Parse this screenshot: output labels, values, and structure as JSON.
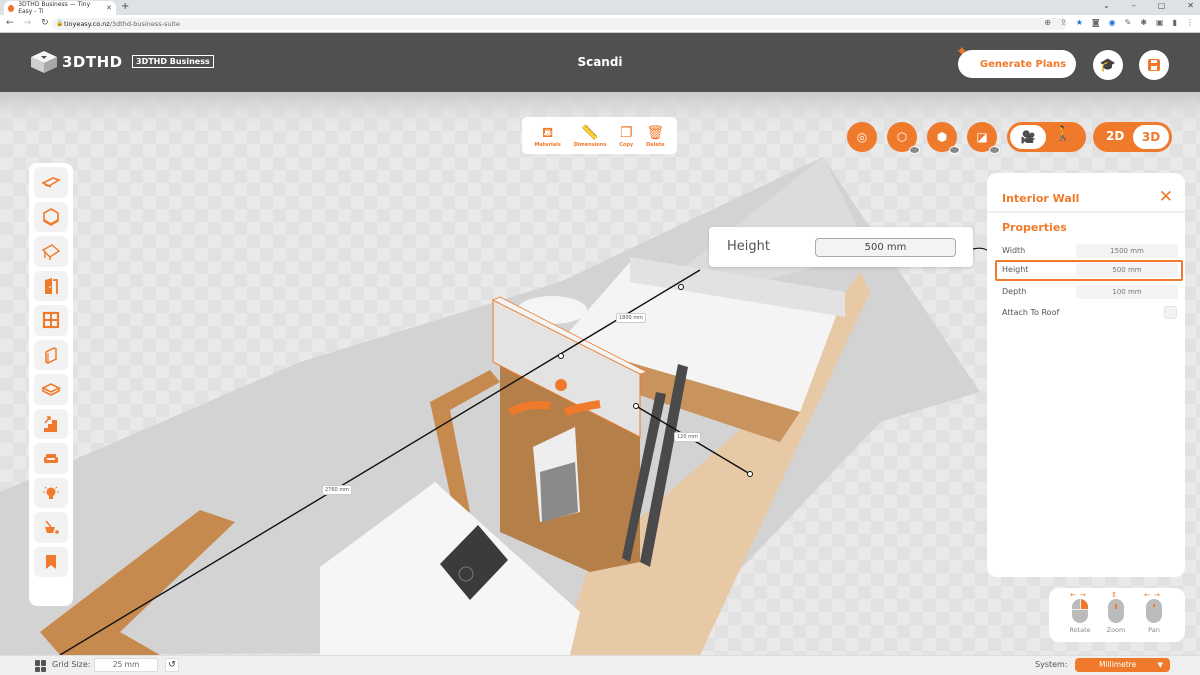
{
  "browser": {
    "tab_title": "3DTHD Business — Tiny Easy - Ti",
    "new_tab": "+",
    "url_host": "tinyeasy.co.nz",
    "url_path": "/3dthd-business-suite",
    "window_controls": [
      "⌄",
      "–",
      "▢",
      "✕"
    ]
  },
  "header": {
    "logo_text": "3DTHD",
    "edition_badge": "3DTHD Business",
    "project_title": "Scandi",
    "generate_plans_label": "Generate Plans",
    "tutorials_icon": "graduation-cap-icon",
    "save_icon": "floppy-disk-icon"
  },
  "context_toolbar": {
    "items": [
      {
        "label": "Materials",
        "icon": "paint-bucket-icon"
      },
      {
        "label": "Dimensions",
        "icon": "ruler-icon"
      },
      {
        "label": "Copy",
        "icon": "copy-icon"
      },
      {
        "label": "Delete",
        "icon": "trash-icon"
      }
    ]
  },
  "view_controls": {
    "buttons": [
      {
        "name": "measure-tape",
        "icon": "tape-measure-icon"
      },
      {
        "name": "toggle-walls-visibility",
        "icon": "walls-eye-icon"
      },
      {
        "name": "toggle-floor-visibility",
        "icon": "floor-eye-icon"
      },
      {
        "name": "toggle-roof-visibility",
        "icon": "roof-eye-icon"
      }
    ],
    "camera_mode": {
      "active": "orbit-camera",
      "options": [
        "orbit-camera",
        "walk"
      ]
    },
    "dimension_mode": {
      "options": [
        "2D",
        "3D"
      ],
      "active": "3D"
    }
  },
  "sidebar": {
    "items": [
      {
        "name": "floor-plan",
        "icon": "floor-plan-icon"
      },
      {
        "name": "box-room",
        "icon": "cube-icon"
      },
      {
        "name": "roof",
        "icon": "roof-icon"
      },
      {
        "name": "doors",
        "icon": "door-icon"
      },
      {
        "name": "windows",
        "icon": "window-icon"
      },
      {
        "name": "walls",
        "icon": "wall-panel-icon"
      },
      {
        "name": "floors",
        "icon": "floor-slab-icon"
      },
      {
        "name": "stairs",
        "icon": "stairs-icon"
      },
      {
        "name": "furniture",
        "icon": "sofa-icon"
      },
      {
        "name": "lighting",
        "icon": "lightbulb-icon"
      },
      {
        "name": "materials",
        "icon": "paint-bucket-icon"
      },
      {
        "name": "bookmarks",
        "icon": "bookmark-icon"
      }
    ]
  },
  "height_popover": {
    "label": "Height",
    "value": "500 mm"
  },
  "properties_panel": {
    "title": "Interior Wall",
    "section": "Properties",
    "rows": [
      {
        "label": "Width",
        "value": "1500 mm"
      },
      {
        "label": "Height",
        "value": "500 mm",
        "active": true
      },
      {
        "label": "Depth",
        "value": "100 mm"
      },
      {
        "label": "Attach To Roof",
        "checked": false
      }
    ]
  },
  "scene": {
    "dimension_labels": [
      "1800 mm",
      "120 mm",
      "2760 mm"
    ]
  },
  "mouse_help": {
    "items": [
      {
        "label": "Rotate"
      },
      {
        "label": "Zoom"
      },
      {
        "label": "Pan"
      }
    ]
  },
  "statusbar": {
    "grid_size_label": "Grid Size:",
    "grid_size_value": "25 mm",
    "system_label": "System:",
    "system_value": "Millimetre"
  },
  "colors": {
    "accent": "#f07a2b",
    "header_bg": "#505050",
    "panel_bg": "#ffffff"
  }
}
